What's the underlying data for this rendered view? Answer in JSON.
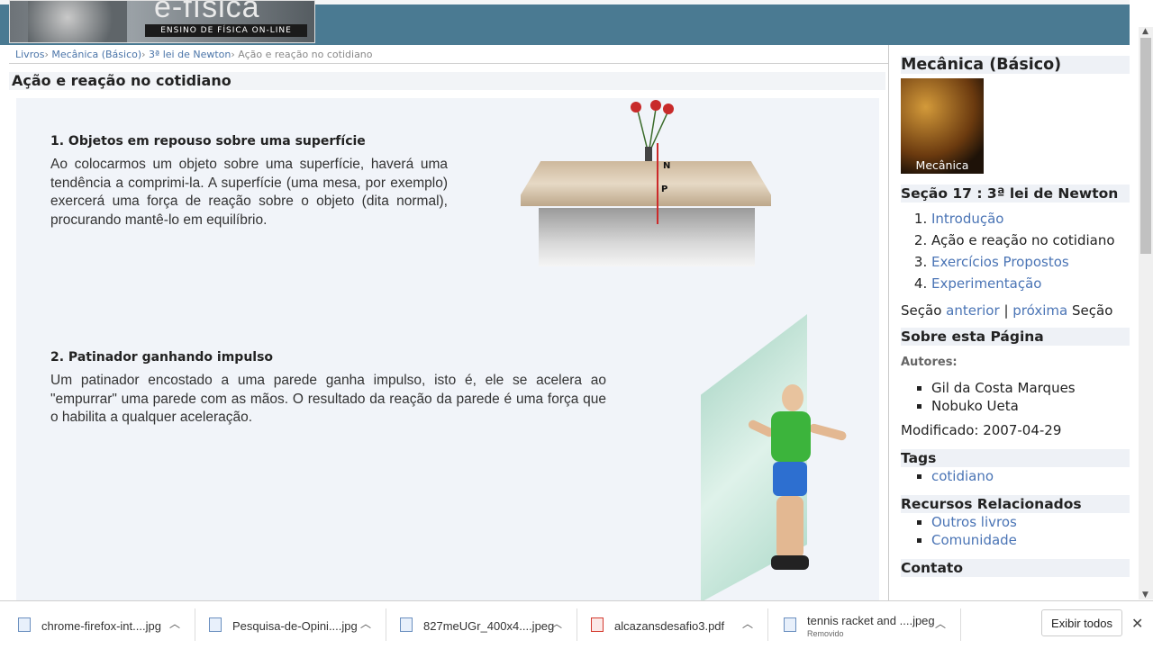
{
  "header": {
    "logo_title": "e-física",
    "logo_subtitle": "ENSINO DE FÍSICA ON-LINE"
  },
  "breadcrumb": [
    {
      "label": "Livros",
      "link": true
    },
    {
      "label": "Mecânica (Básico)",
      "link": true
    },
    {
      "label": "3ª lei de Newton",
      "link": true
    },
    {
      "label": "Ação e reação no cotidiano",
      "link": false
    }
  ],
  "page_title": "Ação e reação no cotidiano",
  "content": {
    "section1": {
      "title": "1. Objetos em repouso sobre uma superfície",
      "text": "Ao colocarmos um objeto sobre uma superfície, haverá uma tendência a comprimi-la. A superfície (uma mesa, por exemplo) exercerá uma força de reação sobre o objeto (dita normal), procurando mantê-lo em equilíbrio.",
      "label_n": "N",
      "label_p": "P"
    },
    "section2": {
      "title": "2. Patinador ganhando impulso",
      "text": "Um patinador encostado a uma parede ganha impulso, isto é, ele se acelera ao \"empurrar\" uma parede com as mãos. O resultado da reação da parede é uma força que o habilita a qualquer aceleração."
    }
  },
  "sidebar": {
    "book_title": "Mecânica (Básico)",
    "book_image_caption": "Mecânica",
    "section_heading": "Seção 17 : 3ª lei de Newton",
    "toc": [
      {
        "label": "Introdução",
        "link": true
      },
      {
        "label": "Ação e reação no cotidiano",
        "link": false
      },
      {
        "label": "Exercícios Propostos",
        "link": true
      },
      {
        "label": "Experimentação",
        "link": true
      }
    ],
    "nav_prefix": "Seção",
    "nav_prev": "anterior",
    "nav_sep": "|",
    "nav_next": "próxima",
    "nav_suffix": "Seção",
    "about_heading": "Sobre esta Página",
    "authors_label": "Autores:",
    "authors": [
      "Gil da Costa Marques",
      "Nobuko Ueta"
    ],
    "modified": "Modificado: 2007-04-29",
    "tags_heading": "Tags",
    "tags": [
      "cotidiano"
    ],
    "related_heading": "Recursos Relacionados",
    "related": [
      "Outros livros",
      "Comunidade"
    ],
    "contact_heading": "Contato"
  },
  "downloads": {
    "items": [
      {
        "name": "chrome-firefox-int....jpg",
        "type": "image",
        "sub": ""
      },
      {
        "name": "Pesquisa-de-Opini....jpg",
        "type": "image",
        "sub": ""
      },
      {
        "name": "827meUGr_400x4....jpeg",
        "type": "image",
        "sub": ""
      },
      {
        "name": "alcazansdesafio3.pdf",
        "type": "pdf",
        "sub": ""
      },
      {
        "name": "tennis racket and ....jpeg",
        "type": "image",
        "sub": "Removido"
      }
    ],
    "show_all": "Exibir todos",
    "close": "✕"
  },
  "colors": {
    "header_bg": "#4a7a92",
    "link": "#4a74b5",
    "content_bg": "#f1f4f9"
  }
}
